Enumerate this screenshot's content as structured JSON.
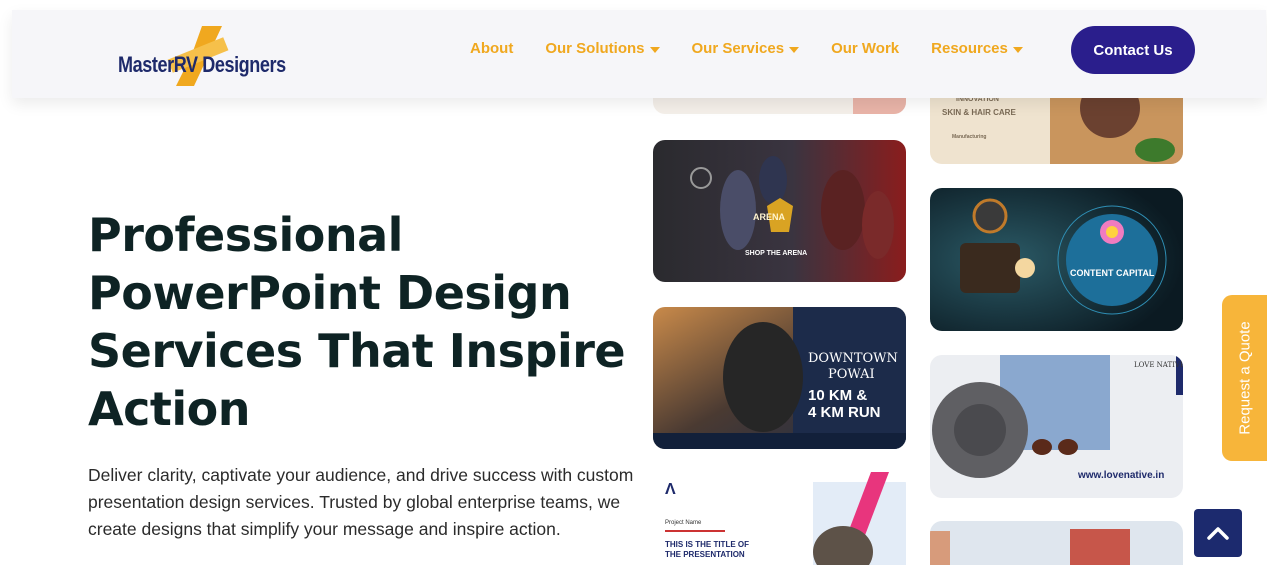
{
  "header": {
    "logo_text": "MasterRV Designers",
    "nav": [
      {
        "label": "About",
        "has_dropdown": false
      },
      {
        "label": "Our Solutions",
        "has_dropdown": true
      },
      {
        "label": "Our Services",
        "has_dropdown": true
      },
      {
        "label": "Our Work",
        "has_dropdown": false
      },
      {
        "label": "Resources",
        "has_dropdown": true
      }
    ],
    "contact_label": "Contact Us"
  },
  "hero": {
    "title": "Professional PowerPoint Design Services That Inspire Action",
    "description": "Deliver clarity, captivate your audience, and drive success with custom presentation design services. Trusted by global enterprise teams, we create designs that simplify your message and inspire action."
  },
  "gallery": {
    "skin_care": {
      "line1": "INNOVATION",
      "line2": "SKIN & HAIR CARE",
      "line3": "Manufacturing"
    },
    "arena": {
      "badge": "ARENA",
      "caption": "SHOP THE ARENA"
    },
    "content_capital": {
      "title": "CONTENT CAPITAL"
    },
    "run": {
      "line1": "DOWNTOWN",
      "line2": "POWAI",
      "line3": "10 KM &",
      "line4": "4 KM RUN"
    },
    "lovenative": {
      "top": "LOVE NATIVE",
      "url": "www.lovenative.in"
    },
    "presentation": {
      "label": "Project Name",
      "title1": "THIS IS THE TITLE OF",
      "title2": "THE PRESENTATION"
    }
  },
  "quote_tab": "Request a Quote",
  "colors": {
    "brand_navy": "#1e2a6b",
    "accent_orange": "#f0a81f",
    "button_purple": "#2a1e8c",
    "quote_orange": "#f7b53a"
  },
  "icons": {
    "scroll_top": "chevron-up-icon",
    "dropdown": "caret-down-icon"
  }
}
